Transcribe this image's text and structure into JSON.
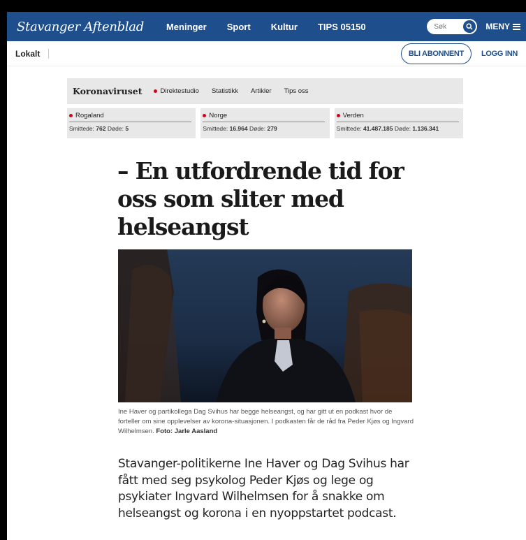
{
  "header": {
    "logo": "Stavanger Aftenblad",
    "nav": [
      "Meninger",
      "Sport",
      "Kultur",
      "TIPS 05150"
    ],
    "search_placeholder": "Søk",
    "menu_label": "MENY"
  },
  "subbar": {
    "section": "Lokalt",
    "subscribe": "BLI ABONNENT",
    "login": "LOGG INN"
  },
  "corona": {
    "title": "Koronaviruset",
    "links": [
      "Direktestudio",
      "Statistikk",
      "Artikler",
      "Tips oss"
    ],
    "stats": [
      {
        "region": "Rogaland",
        "infected_label": "Smittede:",
        "infected": "762",
        "deaths_label": "Døde:",
        "deaths": "5"
      },
      {
        "region": "Norge",
        "infected_label": "Smittede:",
        "infected": "16.964",
        "deaths_label": "Døde:",
        "deaths": "279"
      },
      {
        "region": "Verden",
        "infected_label": "Smittede:",
        "infected": "41.487.185",
        "deaths_label": "Døde:",
        "deaths": "1.136.341"
      }
    ]
  },
  "article": {
    "headline": "– En utfordrende tid for oss som sliter med helseangst",
    "caption": "Ine Haver og partikollega Dag Svihus har begge helseangst, og har gitt ut en podkast hvor de forteller om sine opplevelser av korona-situasjonen. I podkasten får de råd fra Peder Kjøs og Ingvard Wilhelmsen.",
    "photo_credit": "Foto: Jarle Aasland",
    "lead": "Stavanger-politikerne Ine Haver og Dag Svihus har fått med seg psykolog Peder Kjøs og lege og psykiater Ingvard Wilhelmsen for å snakke om helseangst og korona i en nyoppstartet podcast."
  },
  "colors": {
    "brand_blue": "#1e4e8c",
    "red_dot": "#d0021b",
    "panel_gray": "#e8e8e8"
  },
  "icons": [
    "search-icon",
    "hamburger-icon",
    "red-dot-icon"
  ]
}
